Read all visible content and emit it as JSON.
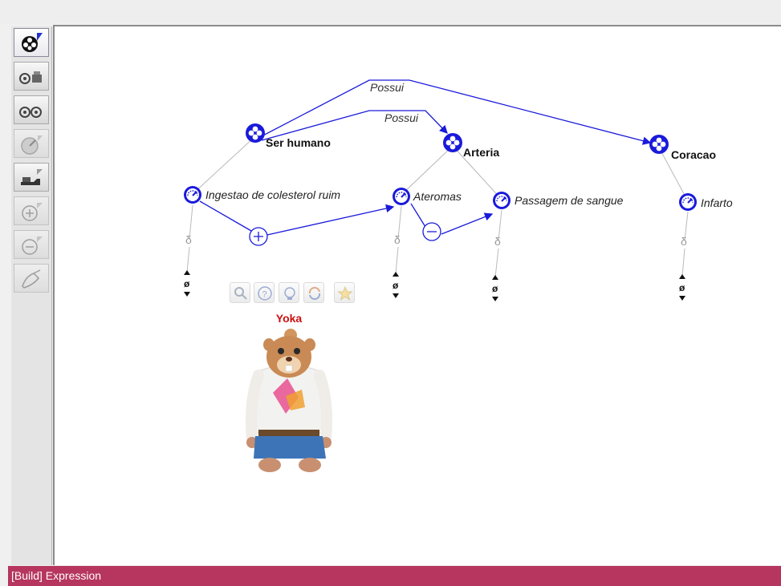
{
  "toolbar": {
    "tools": [
      {
        "icon": "add-concept-icon",
        "active": true
      },
      {
        "icon": "concept-link-icon"
      },
      {
        "icon": "concept-pair-icon"
      },
      {
        "icon": "gauge-add-icon"
      },
      {
        "icon": "hand-add-icon"
      },
      {
        "icon": "plus-circle-icon"
      },
      {
        "icon": "minus-circle-icon"
      },
      {
        "icon": "brush-icon"
      }
    ]
  },
  "graph": {
    "entities": {
      "ser_humano": "Ser humano",
      "arteria": "Arteria",
      "coracao": "Coracao"
    },
    "quantities": {
      "ingestao": "Ingestao de colesterol ruim",
      "ateromas": "Ateromas",
      "passagem": "Passagem de sangue",
      "infarto": "Infarto"
    },
    "relations": {
      "possui_1": "Possui",
      "possui_2": "Possui"
    },
    "derivative_symbol": "δ",
    "zero_symbol": "ø"
  },
  "agent": {
    "name": "Yoka",
    "buttons": [
      "magnifier-icon",
      "help-icon",
      "idea-icon",
      "refresh-icon",
      "star-icon"
    ]
  },
  "status": {
    "text": "[Build] Expression"
  },
  "colors": {
    "status_bar": "#b6365f",
    "link": "#1a1adb",
    "node": "#1a1adb",
    "agent_name": "#cc1111"
  }
}
